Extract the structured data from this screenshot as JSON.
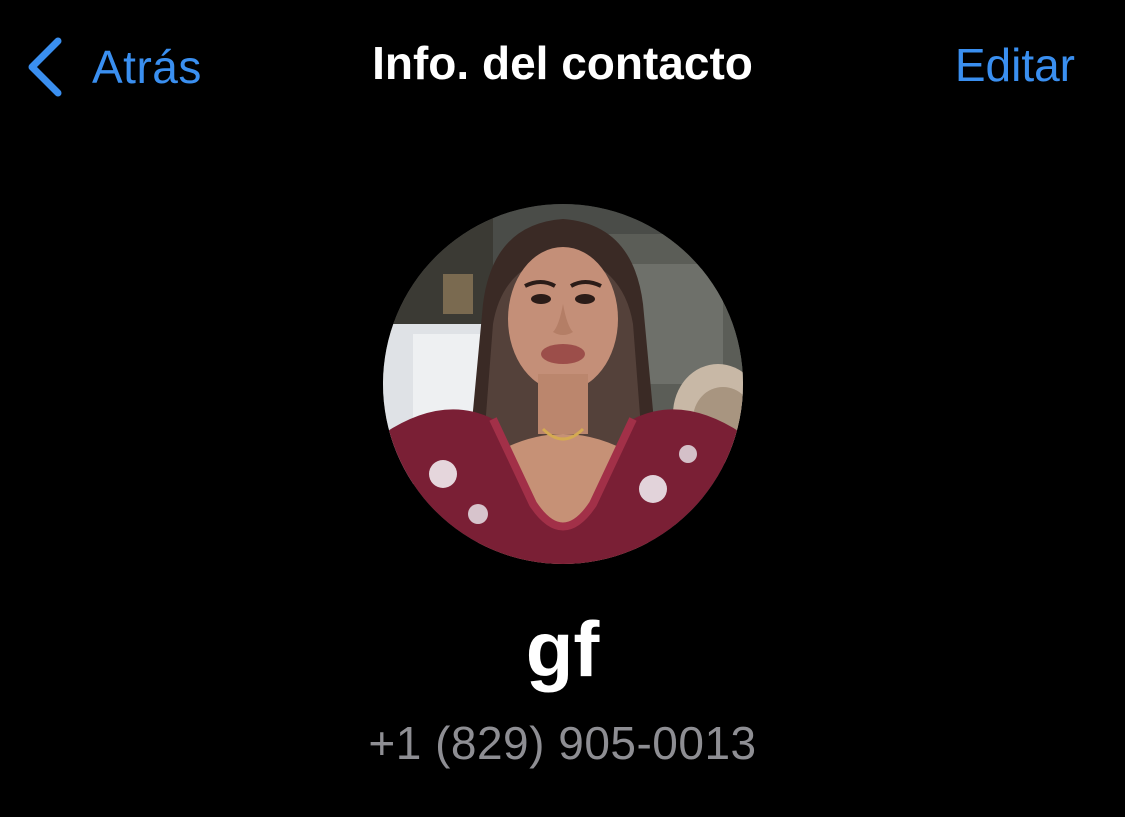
{
  "nav": {
    "back_label": "Atrás",
    "title": "Info. del contacto",
    "edit_label": "Editar",
    "back_icon": "chevron-left-icon"
  },
  "contact": {
    "name": "gf",
    "phone": "+1 (829) 905-0013",
    "avatar": "profile-photo"
  },
  "colors": {
    "background": "#000000",
    "accent": "#3a8ff0",
    "title": "#ffffff",
    "secondary_text": "#8e8e93"
  }
}
